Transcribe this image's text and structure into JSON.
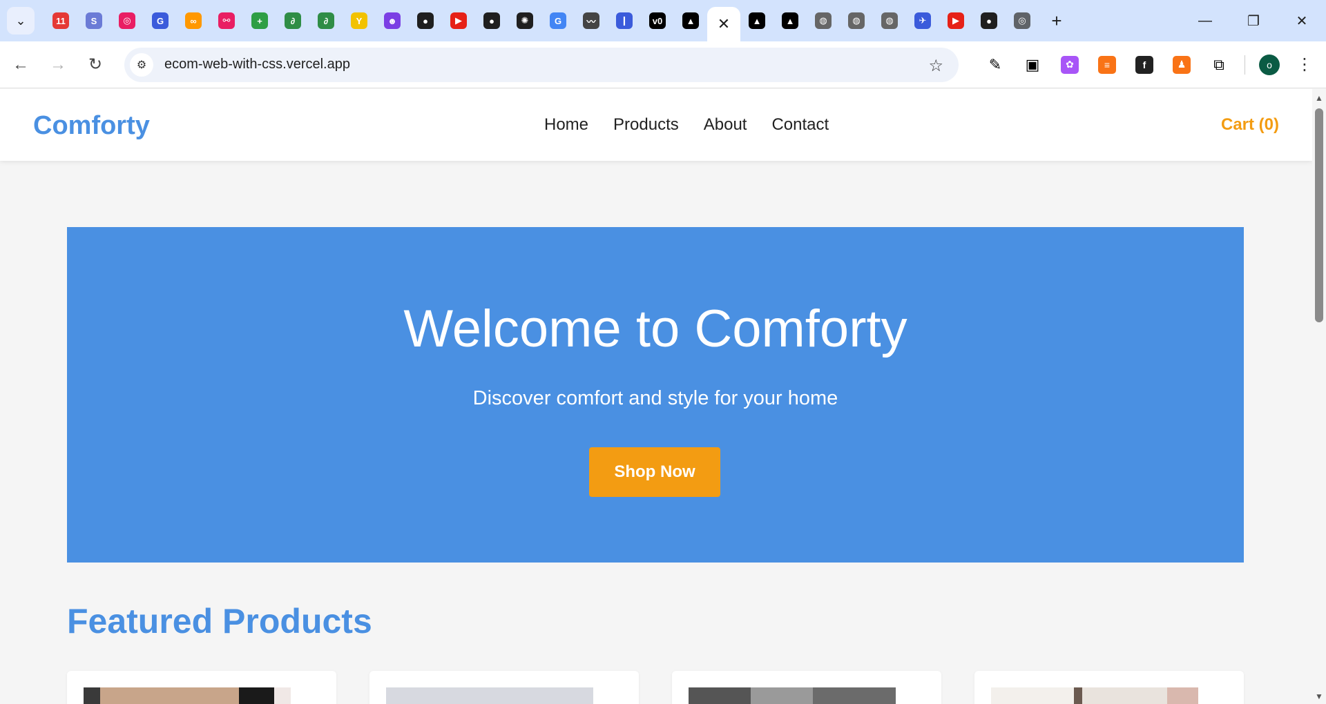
{
  "browser": {
    "tabs": [
      {
        "icon": "calendar-icon",
        "color": "#e53935",
        "glyph": "11"
      },
      {
        "icon": "site-icon",
        "color": "#6b7bd6",
        "glyph": "S"
      },
      {
        "icon": "target-icon",
        "color": "#e91e63",
        "glyph": "◎"
      },
      {
        "icon": "g-icon",
        "color": "#3b5bdb",
        "glyph": "G"
      },
      {
        "icon": "infinity-icon",
        "color": "#ff9800",
        "glyph": "∞"
      },
      {
        "icon": "graph-icon",
        "color": "#e91e63",
        "glyph": "⚯"
      },
      {
        "icon": "plus-sheet-icon",
        "color": "#2e9e44",
        "glyph": "+"
      },
      {
        "icon": "gfg-icon",
        "color": "#2f8d46",
        "glyph": "∂"
      },
      {
        "icon": "gfg-icon",
        "color": "#2f8d46",
        "glyph": "∂"
      },
      {
        "icon": "yn-icon",
        "color": "#f2c200",
        "glyph": "Y"
      },
      {
        "icon": "bot-icon",
        "color": "#7b3fe4",
        "glyph": "☻"
      },
      {
        "icon": "github-icon",
        "color": "#1f1f1f",
        "glyph": "●"
      },
      {
        "icon": "youtube-icon",
        "color": "#e62117",
        "glyph": "▶"
      },
      {
        "icon": "github-icon",
        "color": "#1f1f1f",
        "glyph": "●"
      },
      {
        "icon": "openai-icon",
        "color": "#1f1f1f",
        "glyph": "✺"
      },
      {
        "icon": "google-icon",
        "color": "#4285f4",
        "glyph": "G"
      },
      {
        "icon": "wave-icon",
        "color": "#444444",
        "glyph": "〰"
      },
      {
        "icon": "pill-icon",
        "color": "#3b5bdb",
        "glyph": "❙"
      },
      {
        "icon": "v0-icon",
        "color": "#000000",
        "glyph": "v0"
      },
      {
        "icon": "triangle-icon",
        "color": "#000000",
        "glyph": "▲"
      },
      {
        "icon": "close-icon",
        "color": "#ffffff",
        "glyph": "✕",
        "active": true
      },
      {
        "icon": "triangle-icon",
        "color": "#000000",
        "glyph": "▲"
      },
      {
        "icon": "triangle-icon",
        "color": "#000000",
        "glyph": "▲"
      },
      {
        "icon": "globe-icon",
        "color": "#666666",
        "glyph": "◍"
      },
      {
        "icon": "globe-icon",
        "color": "#666666",
        "glyph": "◍"
      },
      {
        "icon": "globe-icon",
        "color": "#666666",
        "glyph": "◍"
      },
      {
        "icon": "bird-icon",
        "color": "#3b5bdb",
        "glyph": "✈"
      },
      {
        "icon": "youtube-icon",
        "color": "#e62117",
        "glyph": "▶"
      },
      {
        "icon": "github-icon",
        "color": "#1f1f1f",
        "glyph": "●"
      },
      {
        "icon": "chrome-icon",
        "color": "#5f6368",
        "glyph": "◎"
      }
    ],
    "url": "ecom-web-with-css.vercel.app",
    "avatar_letter": "o"
  },
  "site": {
    "logo": "Comforty",
    "nav": [
      "Home",
      "Products",
      "About",
      "Contact"
    ],
    "cart": "Cart (0)"
  },
  "hero": {
    "title": "Welcome to Comforty",
    "subtitle": "Discover comfort and style for your home",
    "cta": "Shop Now"
  },
  "featured": {
    "title": "Featured Products"
  },
  "colors": {
    "primary": "#4a90e2",
    "accent": "#f39c12"
  }
}
